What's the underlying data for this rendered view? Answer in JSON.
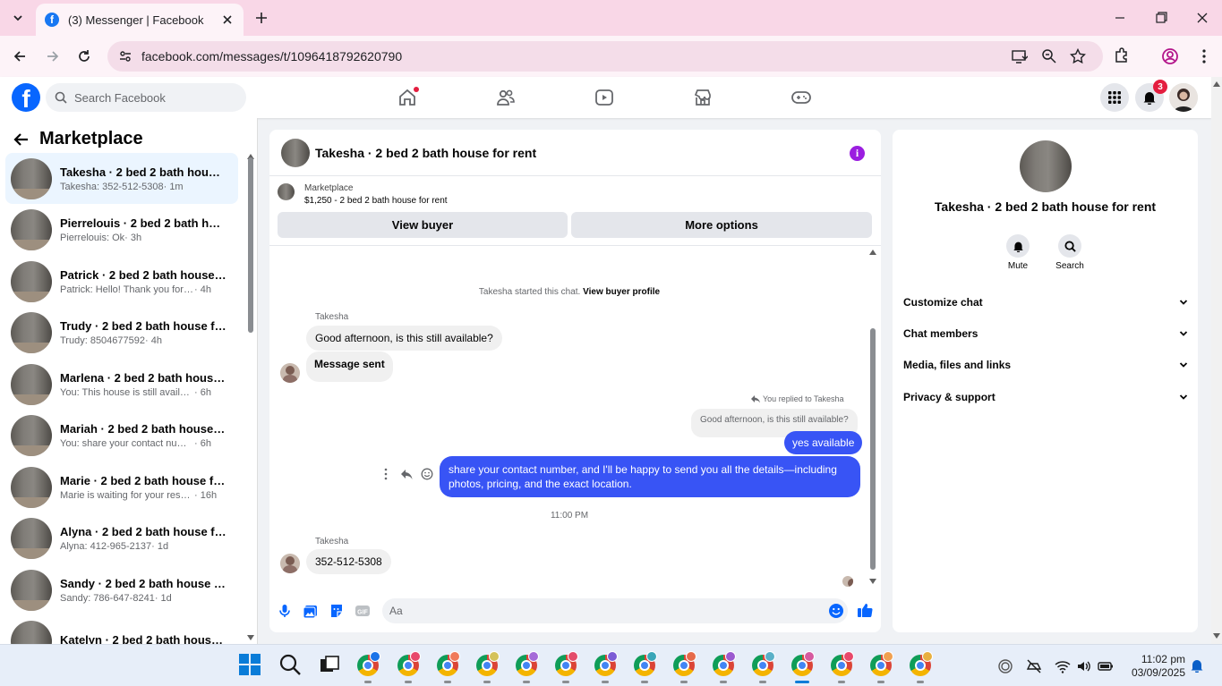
{
  "browser": {
    "tab_title": "(3) Messenger | Facebook",
    "url": "facebook.com/messages/t/1096418792620790"
  },
  "fb": {
    "search_placeholder": "Search Facebook",
    "notification_count": "3"
  },
  "sidebar": {
    "title": "Marketplace",
    "conversations": [
      {
        "name": "Takesha · 2 bed 2 bath house fo...",
        "snippet": "Takesha: 352-512-5308",
        "time": "· 1m"
      },
      {
        "name": "Pierrelouis · 2 bed 2 bath house...",
        "snippet": "Pierrelouis: Ok",
        "time": "· 3h"
      },
      {
        "name": "Patrick · 2 bed 2 bath house for ...",
        "snippet": "Patrick: Hello! Thank you for gettin...",
        "time": "· 4h"
      },
      {
        "name": "Trudy · 2 bed 2 bath house for r...",
        "snippet": "Trudy: 8504677592",
        "time": "· 4h"
      },
      {
        "name": "Marlena · 2 bed 2 bath house fo...",
        "snippet": "You: This house is still available for ...",
        "time": "· 6h"
      },
      {
        "name": "Mariah · 2 bed 2 bath house for...",
        "snippet": "You: share your contact number, a...",
        "time": "· 6h"
      },
      {
        "name": "Marie · 2 bed 2 bath house for r...",
        "snippet": "Marie is waiting for your response.",
        "time": "· 16h"
      },
      {
        "name": "Alyna · 2 bed 2 bath house for r...",
        "snippet": "Alyna: 412-965-2137",
        "time": "· 1d"
      },
      {
        "name": "Sandy · 2 bed 2 bath house for ...",
        "snippet": "Sandy: 786-647-8241",
        "time": "· 1d"
      },
      {
        "name": "Katelyn · 2 bed 2 bath house fo...",
        "snippet": "",
        "time": ""
      }
    ]
  },
  "chat": {
    "title": "Takesha · 2 bed 2 bath house for rent",
    "listing_label": "Marketplace",
    "listing_detail": "$1,250 - 2 bed 2 bath house for rent",
    "view_buyer_label": "View buyer",
    "more_options_label": "More options",
    "system_text": "Takesha started this chat.",
    "system_link": "View buyer profile",
    "sender_name": "Takesha",
    "msg_in_1": "Good afternoon, is this still available?",
    "msg_in_2": "Message sent",
    "replied_label": "You replied to Takesha",
    "quoted_text": "Good afternoon, is this still available?",
    "msg_out_1": "yes available",
    "msg_out_2": "share your contact number, and I'll be happy to send you all the details—including photos, pricing, and the exact location.",
    "time_separator": "11:00 PM",
    "msg_in_3": "352-512-5308",
    "composer_placeholder": "Aa"
  },
  "details": {
    "name": "Takesha · 2 bed 2 bath house for rent",
    "mute_label": "Mute",
    "search_label": "Search",
    "sections": [
      "Customize chat",
      "Chat members",
      "Media, files and links",
      "Privacy & support"
    ]
  },
  "taskbar": {
    "time": "11:02 pm",
    "date": "03/09/2025"
  },
  "colors": {
    "fb_blue": "#0866ff",
    "outgoing_bubble": "#3854f5",
    "tab_bar": "#f9d7e7",
    "badge_red": "#e41e3f",
    "info_purple": "#9b1ee0"
  }
}
